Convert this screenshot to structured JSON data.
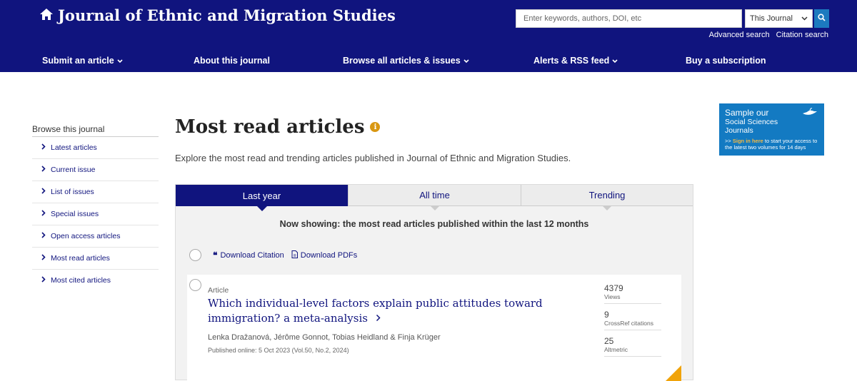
{
  "header": {
    "title": "Journal of Ethnic and Migration Studies",
    "search_placeholder": "Enter keywords, authors, DOI, etc",
    "search_scope": "This Journal",
    "advanced_search": "Advanced search",
    "citation_search": "Citation search"
  },
  "nav": {
    "items": [
      {
        "label": "Submit an article",
        "dropdown": true
      },
      {
        "label": "About this journal",
        "dropdown": false
      },
      {
        "label": "Browse all articles & issues",
        "dropdown": true
      },
      {
        "label": "Alerts & RSS feed",
        "dropdown": true
      },
      {
        "label": "Buy a subscription",
        "dropdown": false
      }
    ]
  },
  "sidebar": {
    "title": "Browse this journal",
    "items": [
      "Latest articles",
      "Current issue",
      "List of issues",
      "Special issues",
      "Open access articles",
      "Most read articles",
      "Most cited articles"
    ]
  },
  "main": {
    "title": "Most read articles",
    "info_icon_text": "i",
    "subtitle": "Explore the most read and trending articles published in Journal of Ethnic and Migration Studies.",
    "tabs": [
      "Last year",
      "All time",
      "Trending"
    ],
    "now_showing": "Now showing: the most read articles published within the last 12 months",
    "download_citation": "Download Citation",
    "download_pdfs": "Download PDFs"
  },
  "article": {
    "type": "Article",
    "title": "Which individual-level factors explain public attitudes toward immigration? a meta-analysis",
    "authors": "Lenka Dražanová, Jérôme Gonnot, Tobias Heidland & Finja Krüger",
    "published": "Published online: 5 Oct 2023 (Vol.50, No.2, 2024)",
    "metrics": [
      {
        "value": "4379",
        "label": "Views"
      },
      {
        "value": "9",
        "label": "CrossRef citations"
      },
      {
        "value": "25",
        "label": "Altmetric"
      }
    ]
  },
  "ad": {
    "line1": "Sample our",
    "line2": "Social Sciences",
    "line3": "Journals",
    "arrows": ">>",
    "signin": "Sign in here",
    "rest": "to start your access to the latest two volumes for 14 days"
  },
  "colors": {
    "header_bg": "#10147e",
    "accent_blue": "#1c7abf",
    "info_orange": "#d99712",
    "ad_bg": "#137ac2"
  }
}
